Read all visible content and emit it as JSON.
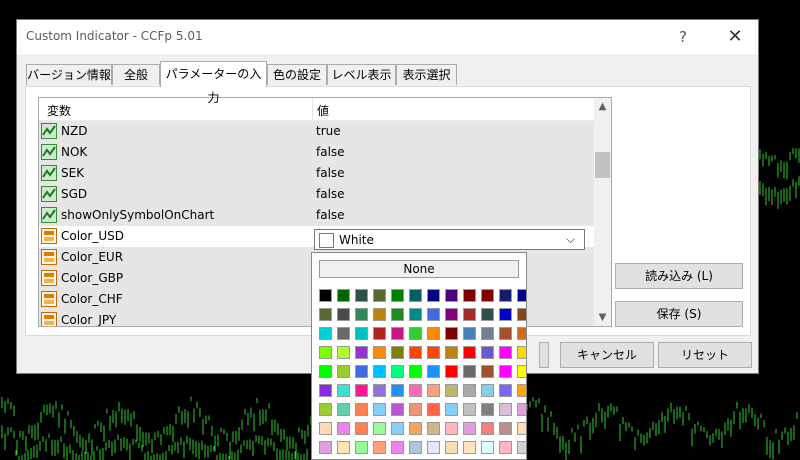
{
  "dialog": {
    "title": "Custom Indicator - CCFp 5.01",
    "help_label": "?",
    "close_label": "✕"
  },
  "tabs": [
    {
      "label": "バージョン情報",
      "active": false
    },
    {
      "label": "全般",
      "active": false
    },
    {
      "label": "パラメーターの入力",
      "active": true
    },
    {
      "label": "色の設定",
      "active": false
    },
    {
      "label": "レベル表示",
      "active": false
    },
    {
      "label": "表示選択",
      "active": false
    }
  ],
  "table": {
    "headers": {
      "variable": "変数",
      "value": "値"
    },
    "rows": [
      {
        "name": "NZD",
        "value": "true",
        "icon": "bool-parameter-icon"
      },
      {
        "name": "NOK",
        "value": "false",
        "icon": "bool-parameter-icon"
      },
      {
        "name": "SEK",
        "value": "false",
        "icon": "bool-parameter-icon"
      },
      {
        "name": "SGD",
        "value": "false",
        "icon": "bool-parameter-icon"
      },
      {
        "name": "showOnlySymbolOnChart",
        "value": "false",
        "icon": "bool-parameter-icon"
      },
      {
        "name": "Color_USD",
        "value": "",
        "icon": "color-parameter-icon"
      },
      {
        "name": "Color_EUR",
        "value": "",
        "icon": "color-parameter-icon"
      },
      {
        "name": "Color_GBP",
        "value": "",
        "icon": "color-parameter-icon"
      },
      {
        "name": "Color_CHF",
        "value": "",
        "icon": "color-parameter-icon"
      },
      {
        "name": "Color_JPY",
        "value": "",
        "icon": "color-parameter-icon"
      }
    ],
    "selected_row": "Color_USD"
  },
  "color_select": {
    "value": "White",
    "swatch": "#ffffff",
    "none_label": "None"
  },
  "buttons": {
    "load": "読み込み (L)",
    "save": "保存 (S)",
    "cancel": "キャンセル",
    "reset": "リセット"
  },
  "palette": [
    [
      "#000000",
      "#006400",
      "#2f4f4f",
      "#556b2f",
      "#008000",
      "#006060",
      "#000080",
      "#4b0082",
      "#800000",
      "#800000",
      "#191970",
      "#00008b"
    ],
    [
      "#556b2f",
      "#4b4b4b",
      "#2e8b57",
      "#b8860b",
      "#228b22",
      "#008b8b",
      "#4169e1",
      "#800080",
      "#a52a2a",
      "#2f4f4f",
      "#0000cd",
      "#8b4513"
    ],
    [
      "#00ced1",
      "#696969",
      "#00bfbf",
      "#b22222",
      "#c71585",
      "#32cd32",
      "#ff8c00",
      "#800000",
      "#4682b4",
      "#708090",
      "#a0522d",
      "#d2691e"
    ],
    [
      "#7fff00",
      "#adff2f",
      "#9932cc",
      "#ff8c00",
      "#808000",
      "#ff4500",
      "#ff4500",
      "#b8860b",
      "#ff0000",
      "#6a5acd",
      "#ff00ff",
      "#ffd700"
    ],
    [
      "#00ff00",
      "#9acd32",
      "#4169e1",
      "#00bfff",
      "#00ff7f",
      "#00ff00",
      "#1e90ff",
      "#ff0000",
      "#696969",
      "#a0522d",
      "#ff00ff",
      "#ffff00"
    ],
    [
      "#8a2be2",
      "#40e0d0",
      "#ff1493",
      "#9370db",
      "#1e90ff",
      "#ff69b4",
      "#ffa07a",
      "#bdb76b",
      "#a9a9a9",
      "#87ceeb",
      "#7b68ee",
      "#ffa500"
    ],
    [
      "#9acd32",
      "#66cdaa",
      "#ff7f50",
      "#87cefa",
      "#ba55d3",
      "#e9967a",
      "#ff6347",
      "#87cefa",
      "#c0c0c0",
      "#808080",
      "#d8bfd8",
      "#dda0dd"
    ],
    [
      "#ffdab9",
      "#ee82ee",
      "#ff7f50",
      "#98fb98",
      "#87cefa",
      "#f4a460",
      "#d2b48c",
      "#ffb6c1",
      "#dda0dd",
      "#f08080",
      "#bc8f8f",
      "#ffdead"
    ],
    [
      "#dda0dd",
      "#ffe4b5",
      "#98fb98",
      "#ffa07a",
      "#ee82ee",
      "#b0c4de",
      "#e6e6fa",
      "#f5deb3",
      "#ffe4c4",
      "#e0ffff",
      "#ffb6c1",
      "#d3d3d3"
    ]
  ]
}
